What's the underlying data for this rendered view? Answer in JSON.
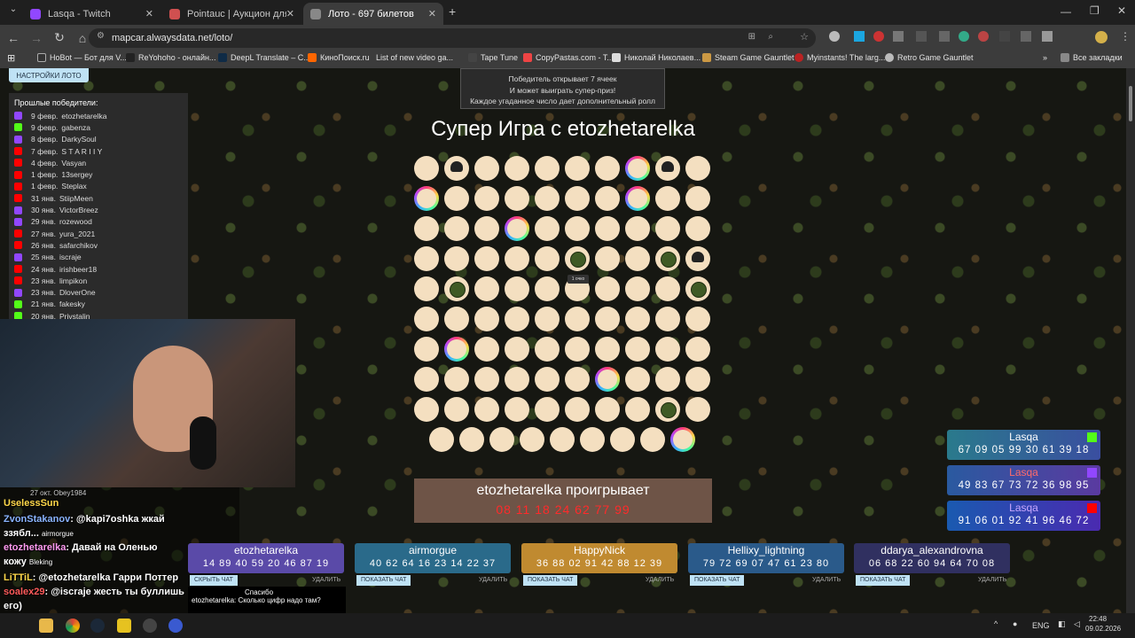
{
  "tabs": [
    {
      "title": "Lasqa - Twitch",
      "color": "#9147ff"
    },
    {
      "title": "Pointauc | Аукцион для стрим...",
      "color": "#d05050"
    },
    {
      "title": "Лото - 697 билетов",
      "color": "#888888",
      "active": true
    }
  ],
  "address": "mapcar.alwaysdata.net/loto/",
  "bookmarks": [
    "HoBot — Бот для V...",
    "ReYohoho - онлайн...",
    "DeepL Translate – С...",
    "КиноПоиск.ru",
    "List of new video ga...",
    "Tape Tune",
    "CopyPastas.com - T...",
    "Николай Николаев...",
    "Steam Game Gauntlet",
    "Myinstants! The larg...",
    "Retro Game Gauntlet"
  ],
  "all_bookmarks": "Все закладки",
  "settings_button": "НАСТРОЙКИ ЛОТО",
  "winners": {
    "title": "Прошлые победители:",
    "items": [
      {
        "date": "9 февр.",
        "name": "etozhetarelka",
        "p": "tw"
      },
      {
        "date": "9 февр.",
        "name": "gabenza",
        "p": "kk"
      },
      {
        "date": "8 февр.",
        "name": "DarkySoul",
        "p": "tw"
      },
      {
        "date": "7 февр.",
        "name": "S T A R I I Y",
        "p": "yt"
      },
      {
        "date": "4 февр.",
        "name": "Vasyan",
        "p": "yt"
      },
      {
        "date": "1 февр.",
        "name": "13sergey",
        "p": "yt"
      },
      {
        "date": "1 февр.",
        "name": "Steplax",
        "p": "yt"
      },
      {
        "date": "31 янв.",
        "name": "StiipMeen",
        "p": "yt"
      },
      {
        "date": "30 янв.",
        "name": "VictorBreez",
        "p": "tw"
      },
      {
        "date": "29 янв.",
        "name": "rozewood",
        "p": "tw"
      },
      {
        "date": "27 янв.",
        "name": "yura_2021",
        "p": "yt"
      },
      {
        "date": "26 янв.",
        "name": "safarchikov",
        "p": "yt"
      },
      {
        "date": "25 янв.",
        "name": "iscraje",
        "p": "tw"
      },
      {
        "date": "24 янв.",
        "name": "irishbeer18",
        "p": "yt"
      },
      {
        "date": "23 янв.",
        "name": "limpikon",
        "p": "yt"
      },
      {
        "date": "23 янв.",
        "name": "DloverOne",
        "p": "tw"
      },
      {
        "date": "21 янв.",
        "name": "fakesky",
        "p": "kk"
      },
      {
        "date": "20 янв.",
        "name": "Privstalin",
        "p": "kk"
      }
    ]
  },
  "info_box": [
    "Победитель открывает 7 ячеек",
    "И может выиграть супер-приз!",
    "Каждое угаданное число дает дополнительный ролл"
  ],
  "game_title": "Супер Игра с etozhetarelka",
  "tooltip": "1 очко",
  "result": {
    "text": "etozhetarelka проигрывает",
    "numbers": "08 11 18 24 62 77 99"
  },
  "right_cards": [
    {
      "name": "Lasqa",
      "values": "67 09 05 99 30 61 39 18"
    },
    {
      "name": "Lasqa",
      "values": "49 83 67 73 72 36 98 95"
    },
    {
      "name": "Lasqa",
      "values": "91 06 01 92 41 96 46 72"
    }
  ],
  "player_cards": [
    {
      "name": "etozhetarelka",
      "values": "14 89 40 59 20 46 87 19",
      "bg": "#5a4aa8",
      "button": "СКРЫТЬ ЧАТ"
    },
    {
      "name": "airmorgue",
      "values": "40 62 64 16 23 14 22 37",
      "bg": "#2a6a8a",
      "button": "ПОКАЗАТЬ ЧАТ"
    },
    {
      "name": "HappyNick",
      "values": "36 88 02 91 42 88 12 39",
      "bg": "#c08a30",
      "button": "ПОКАЗАТЬ ЧАТ"
    },
    {
      "name": "Hellixy_lightning",
      "values": "79 72 69 07 47 61 23 80",
      "bg": "#2a5a8a",
      "button": "ПОКАЗАТЬ ЧАТ"
    },
    {
      "name": "ddarya_alexandrovna",
      "values": "06 68 22 60 94 64 70 08",
      "bg": "#303060",
      "button": "ПОКАЗАТЬ ЧАТ"
    }
  ],
  "delete_label": "УДАЛИТЬ",
  "chat_left": [
    {
      "user": "27 окт. Obey1984",
      "msg": ""
    },
    {
      "user": "UselessSun",
      "msg": ""
    },
    {
      "user": "ZvonStakanov",
      "msg": ": @kapi7oshka жкай"
    },
    {
      "user": "ззябл...",
      "msg": "airmorgue"
    },
    {
      "user": "etozhetarelka",
      "msg": ": Давай на Оленью"
    },
    {
      "user": "кожу",
      "msg": "Bleking"
    },
    {
      "user": "LiTTiL",
      "msg": ": @etozhetarelka Гарри Поттер"
    },
    {
      "user": "soalex29",
      "msg": ": @iscraje жесть ты буллишь"
    },
    {
      "user": "его)",
      "msg": ""
    }
  ],
  "chat_bottom": [
    "Спасибо",
    "etozhetarelka: Сколько цифр надо там?"
  ],
  "taskbar": {
    "lang": "ENG",
    "time": "22:48",
    "date": "09.02.2026"
  }
}
